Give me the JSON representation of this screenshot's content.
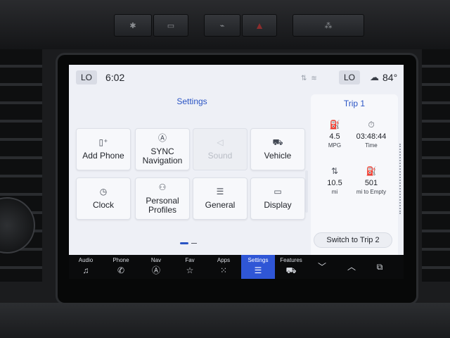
{
  "status_bar": {
    "left_climate": "LO",
    "time": "6:02",
    "right_climate": "LO",
    "temperature": "84°",
    "weather_icon": "cloud-sun-icon",
    "status_icons": [
      "arrows-icon",
      "wifi-icon"
    ]
  },
  "settings": {
    "title": "Settings",
    "tiles": [
      {
        "label": "Add Phone",
        "icon": "phone-add-icon",
        "enabled": true
      },
      {
        "label": "SYNC Navigation",
        "icon": "navigation-icon",
        "enabled": true
      },
      {
        "label": "Sound",
        "icon": "speaker-icon",
        "enabled": false
      },
      {
        "label": "Vehicle",
        "icon": "car-settings-icon",
        "enabled": true
      },
      {
        "label": "Clock",
        "icon": "clock-icon",
        "enabled": true
      },
      {
        "label": "Personal Profiles",
        "icon": "profiles-icon",
        "enabled": true
      },
      {
        "label": "General",
        "icon": "sliders-icon",
        "enabled": true
      },
      {
        "label": "Display",
        "icon": "display-icon",
        "enabled": true
      }
    ],
    "page_count": 2,
    "current_page": 1
  },
  "trip": {
    "title": "Trip 1",
    "metrics": [
      {
        "value": "4.5",
        "unit": "MPG",
        "icon": "fuel-economy-icon"
      },
      {
        "value": "03:48:44",
        "unit": "Time",
        "icon": "stopwatch-icon"
      },
      {
        "value": "10.5",
        "unit": "mi",
        "icon": "distance-icon"
      },
      {
        "value": "501",
        "unit": "mi to Empty",
        "icon": "fuel-pump-icon"
      }
    ],
    "switch_label": "Switch to Trip 2"
  },
  "nav": {
    "items": [
      {
        "label": "Audio",
        "icon": "music-note-icon"
      },
      {
        "label": "Phone",
        "icon": "phone-icon"
      },
      {
        "label": "Nav",
        "icon": "navigation-icon"
      },
      {
        "label": "Fav",
        "icon": "star-icon"
      },
      {
        "label": "Apps",
        "icon": "apps-grid-icon"
      },
      {
        "label": "Settings",
        "icon": "sliders-icon",
        "active": true
      },
      {
        "label": "Features",
        "icon": "car-icon"
      }
    ],
    "extra": [
      {
        "icon": "chevron-down-icon"
      },
      {
        "icon": "chevron-up-icon"
      },
      {
        "icon": "copy-screens-icon"
      }
    ]
  },
  "colors": {
    "accent": "#2a54c4",
    "active_nav": "#2f56d6",
    "screen_bg": "#eef0f6",
    "nav_bg": "#0a0b0c"
  }
}
